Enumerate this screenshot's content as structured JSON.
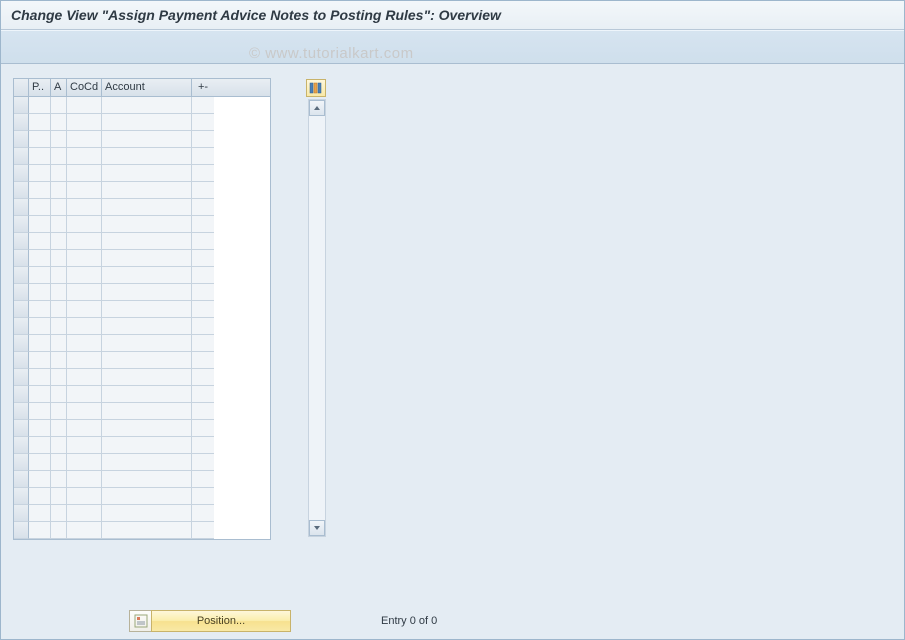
{
  "title": "Change View \"Assign Payment Advice Notes to Posting Rules\": Overview",
  "watermark": "© www.tutorialkart.com",
  "grid": {
    "columns": [
      "P..",
      "A",
      "CoCd",
      "Account",
      "+-"
    ],
    "row_count": 26
  },
  "footer": {
    "position_label": "Position...",
    "entry_text": "Entry 0 of 0"
  }
}
